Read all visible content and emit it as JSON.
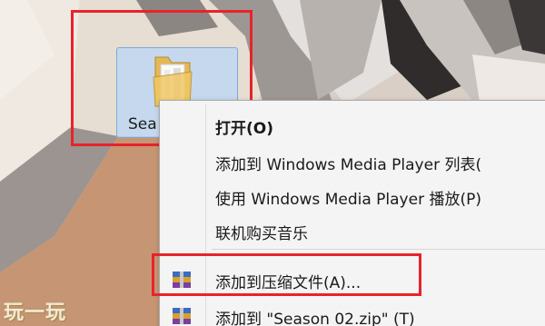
{
  "desktop": {
    "folder": {
      "label_visible": "Sea",
      "icon": "folder-icon",
      "selected": true
    }
  },
  "context_menu": {
    "items": [
      {
        "label": "打开(O)",
        "bold": true,
        "icon": null
      },
      {
        "label": "添加到 Windows Media Player 列表(",
        "icon": null
      },
      {
        "label": "使用 Windows Media Player 播放(P)",
        "icon": null
      },
      {
        "label": "联机购买音乐",
        "icon": null
      },
      {
        "label": "添加到压缩文件(A)...",
        "icon": "winrar-archive-icon"
      },
      {
        "label": "添加到 \"Season 02.zip\" (T)",
        "icon": "winrar-archive-icon"
      }
    ]
  },
  "highlight_color": "#e8232b",
  "watermark": "玩一玩"
}
